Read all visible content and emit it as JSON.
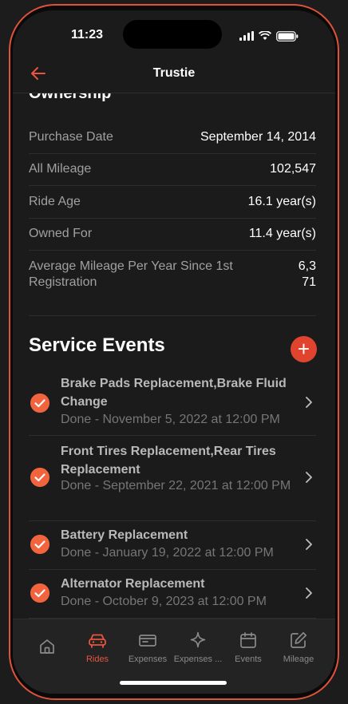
{
  "status": {
    "time": "11:23"
  },
  "nav": {
    "title": "Trustie"
  },
  "ownership": {
    "heading": "Ownership",
    "rows": [
      {
        "label": "Purchase Date",
        "value": "September 14, 2014"
      },
      {
        "label": "All Mileage",
        "value": "102,547"
      },
      {
        "label": "Ride Age",
        "value": "16.1 year(s)"
      },
      {
        "label": "Owned For",
        "value": "11.4 year(s)"
      },
      {
        "label": "Average Mileage Per Year Since 1st Registration",
        "value": "6,371"
      }
    ]
  },
  "service": {
    "title": "Service Events",
    "add_label": "+",
    "events": [
      {
        "title": "Brake Pads Replacement,Brake Fluid Change",
        "status": "Done - November 5, 2022 at 12:00 PM"
      },
      {
        "title": "Front Tires Replacement,Rear Tires Replacement",
        "status": "Done - September 22, 2021 at 12:00 PM"
      },
      {
        "title": "Battery Replacement",
        "status": "Done - January 19, 2022 at 12:00 PM"
      },
      {
        "title": "Alternator Replacement",
        "status": "Done - October 9, 2023 at 12:00 PM"
      }
    ]
  },
  "tabs": [
    {
      "label": ""
    },
    {
      "label": "Rides"
    },
    {
      "label": "Expenses"
    },
    {
      "label": "Expenses ..."
    },
    {
      "label": "Events"
    },
    {
      "label": "Mileage"
    }
  ],
  "colors": {
    "accent": "#e8553e",
    "background": "#1b1b1b"
  }
}
